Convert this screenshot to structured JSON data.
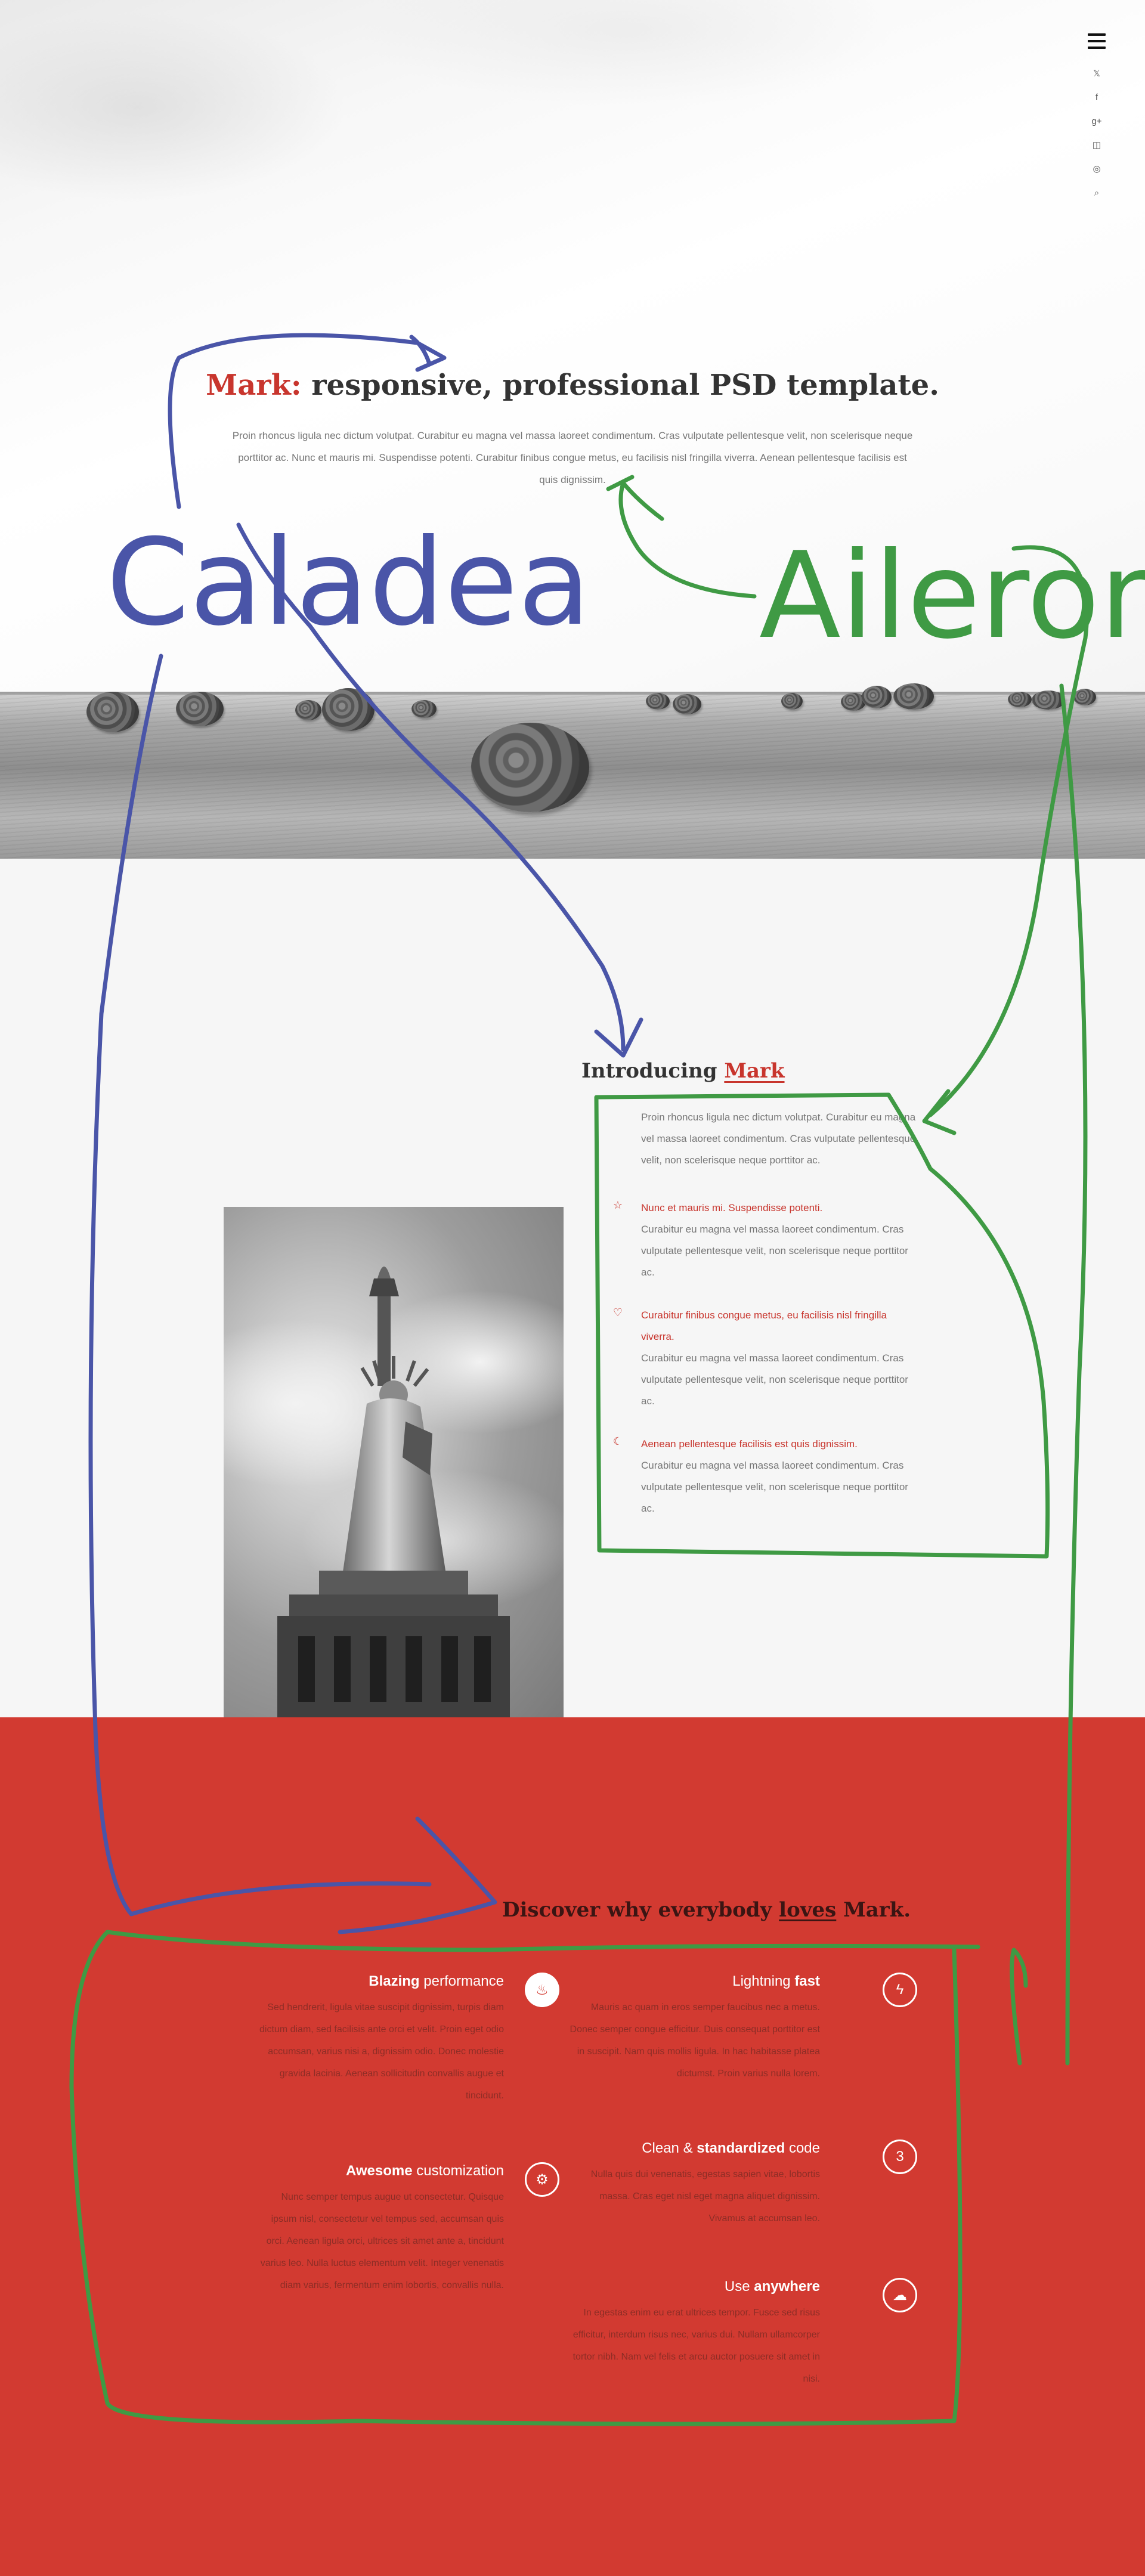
{
  "hero": {
    "title_accent": "Mark:",
    "title_rest": " responsive, professional PSD template.",
    "text": "Proin rhoncus ligula nec dictum volutpat. Curabitur eu magna vel massa laoreet condimentum. Cras vulputate pellentesque velit, non scelerisque neque porttitor ac. Nunc et mauris mi. Suspendisse potenti. Curabitur finibus congue metus, eu facilisis nisl fringilla viverra. Aenean pellentesque facilisis est quis dignissim."
  },
  "nav": {
    "social_icons": [
      {
        "icon": "twitter-icon",
        "glyph": "𝕏"
      },
      {
        "icon": "facebook-icon",
        "glyph": "f"
      },
      {
        "icon": "google-plus-icon",
        "glyph": "g+"
      },
      {
        "icon": "instagram-icon",
        "glyph": "◫"
      },
      {
        "icon": "dribbble-icon",
        "glyph": "◎"
      },
      {
        "icon": "search-icon",
        "glyph": "⌕"
      }
    ]
  },
  "annotations": {
    "blue_font": "Caladea",
    "green_font": "Aileron",
    "blue_color": "#4a55a8",
    "green_color": "#3f9a44"
  },
  "intro": {
    "title_plain": "Introducing ",
    "title_accent": "Mark",
    "lead": "Proin rhoncus ligula nec dictum volutpat. Curabitur eu magna vel massa laoreet condimentum. Cras vulputate pellentesque velit, non scelerisque neque porttitor ac.",
    "features": [
      {
        "icon": "star-icon",
        "glyph": "☆",
        "heading": "Nunc et mauris mi. Suspendisse potenti.",
        "body": "Curabitur eu magna vel massa laoreet condimentum. Cras vulputate pellentesque velit, non scelerisque neque porttitor ac."
      },
      {
        "icon": "heart-icon",
        "glyph": "♡",
        "heading": "Curabitur finibus congue metus, eu facilisis nisl fringilla viverra.",
        "body": "Curabitur eu magna vel massa laoreet condimentum. Cras vulputate pellentesque velit, non scelerisque neque porttitor ac."
      },
      {
        "icon": "moon-icon",
        "glyph": "☾",
        "heading": "Aenean pellentesque facilisis est quis dignissim.",
        "body": "Curabitur eu magna vel massa laoreet condimentum. Cras vulputate pellentesque velit, non scelerisque neque porttitor ac."
      }
    ]
  },
  "why": {
    "title_a": "Discover why everybody ",
    "title_u": "loves",
    "title_b": " Mark.",
    "left": [
      {
        "bold": "Blazing",
        "rest": " performance",
        "bold_first": true,
        "icon": "flame-icon",
        "glyph": "♨",
        "style": "filled",
        "text": "Sed hendrerit, ligula vitae suscipit dignissim, turpis diam dictum diam, sed facilisis ante orci et velit. Proin eget odio accumsan, varius nisi a, dignissim odio. Donec molestie gravida lacinia. Aenean sollicitudin convallis augue et tincidunt."
      },
      {
        "bold": "Awesome",
        "rest": " customization",
        "bold_first": true,
        "icon": "gear-icon",
        "glyph": "⚙",
        "style": "outline",
        "text": "Nunc semper tempus augue ut consectetur. Quisque ipsum nisl, consectetur vel tempus sed, accumsan quis orci. Aenean ligula orci, ultrices sit amet ante a, tincidunt varius leo. Nulla luctus elementum velit. Integer venenatis diam varius, fermentum enim lobortis, convallis nulla."
      }
    ],
    "right": [
      {
        "plain": "Lightning ",
        "bold": "fast",
        "bold_first": false,
        "icon": "lightning-icon",
        "glyph": "ϟ",
        "style": "outline",
        "text": "Mauris ac quam in eros semper faucibus nec a metus. Donec semper congue efficitur. Duis consequat porttitor est in suscipit. Nam quis mollis ligula. In hac habitasse platea dictumst. Proin varius nulla lorem."
      },
      {
        "plain": "Clean & ",
        "bold": "standardized",
        "rest": " code",
        "bold_first": false,
        "icon": "css3-icon",
        "glyph": "3",
        "style": "outline",
        "text": "Nulla quis dui venenatis, egestas sapien vitae, lobortis massa. Cras eget nisl eget magna aliquet dignissim. Vivamus at accumsan leo."
      },
      {
        "plain": "Use ",
        "bold": "anywhere",
        "bold_first": false,
        "icon": "cloud-icon",
        "glyph": "☁",
        "style": "outline",
        "text": "In egestas enim eu erat ultrices tempor. Fusce sed risus efficitur, interdum risus nec, varius dui. Nullam ullamcorper tortor nibh. Nam vel felis et arcu auctor posuere sit amet in nisi."
      }
    ]
  },
  "colors": {
    "accent": "#c8352d",
    "section_red": "#d23a31"
  }
}
